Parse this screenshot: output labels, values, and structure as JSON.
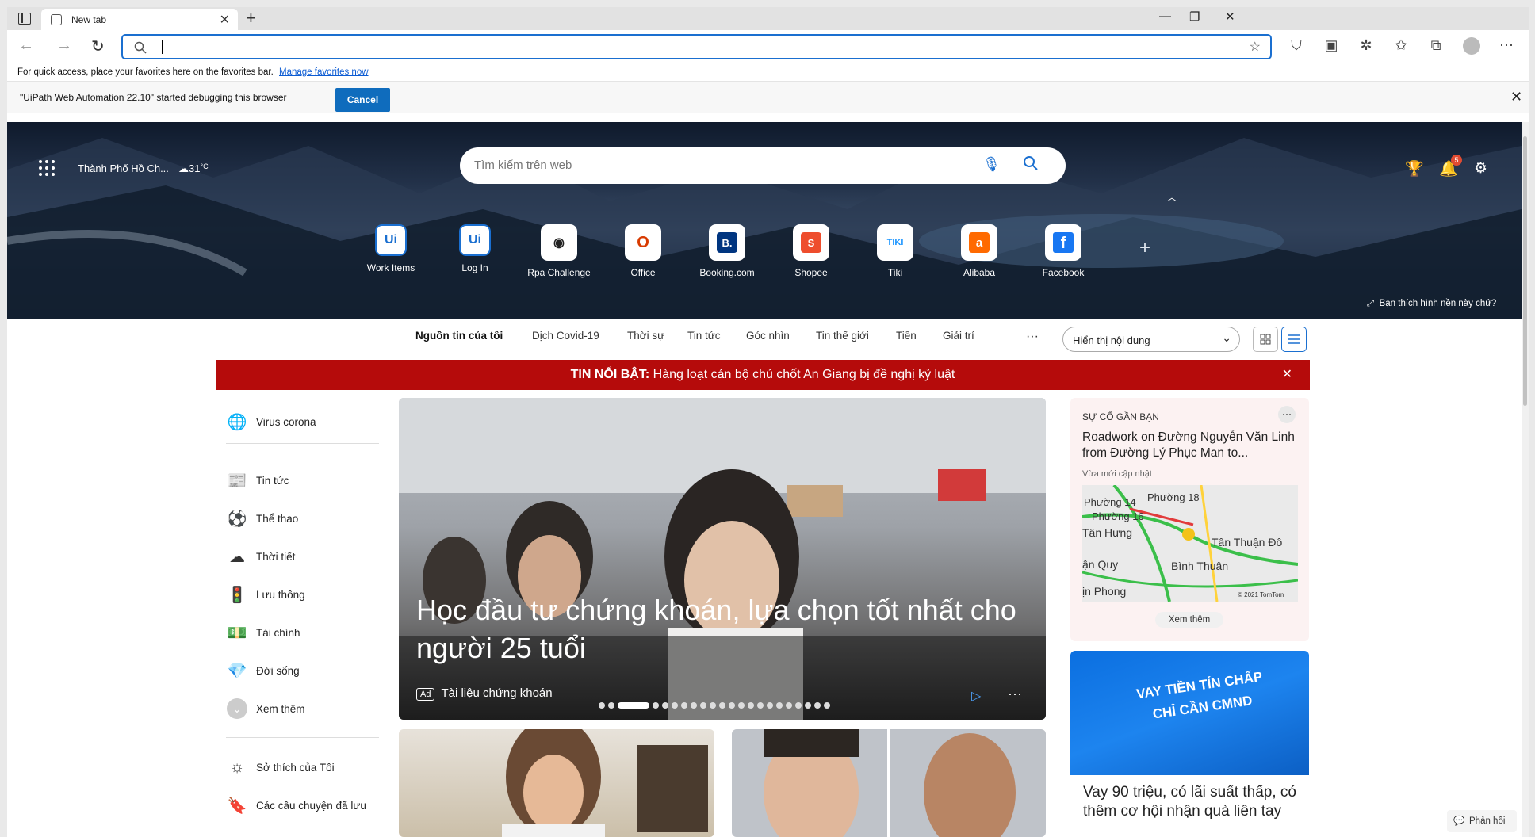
{
  "browser": {
    "tab_title": "New tab",
    "favorites_msg": "For quick access, place your favorites here on the favorites bar.",
    "favorites_link": "Manage favorites now",
    "info_msg": "\"UiPath Web Automation 22.10\" started debugging this browser",
    "cancel_label": "Cancel"
  },
  "hero": {
    "location": "Thành Phố Hồ Ch...",
    "temperature": "31",
    "temp_unit": "°C",
    "search_placeholder": "Tìm kiếm trên web",
    "notification_count": "5",
    "wallpaper_text": "Bạn thích hình nền này chứ?",
    "tiles": [
      {
        "label": "Work Items",
        "glyph": "Ui",
        "color": "#1a6fd0"
      },
      {
        "label": "Log In",
        "glyph": "Ui",
        "color": "#1a6fd0"
      },
      {
        "label": "Rpa Challenge",
        "glyph": "◉",
        "color": "#222222"
      },
      {
        "label": "Office",
        "glyph": "O",
        "color": "#d83b01"
      },
      {
        "label": "Booking.com",
        "glyph": "B.",
        "color": "#ffffff"
      },
      {
        "label": "Shopee",
        "glyph": "S",
        "color": "#ffffff"
      },
      {
        "label": "Tiki",
        "glyph": "TIKI",
        "color": "#1a94ff"
      },
      {
        "label": "Alibaba",
        "glyph": "a",
        "color": "#ffffff"
      },
      {
        "label": "Facebook",
        "glyph": "f",
        "color": "#ffffff"
      }
    ]
  },
  "news_nav": {
    "items": [
      "Nguồn tin của tôi",
      "Dịch Covid-19",
      "Thời sự",
      "Tin tức",
      "Góc nhìn",
      "Tin thế giới",
      "Tiền",
      "Giải trí"
    ],
    "more": "···",
    "dropdown": "Hiển thị nội dung"
  },
  "breaking": {
    "label": "TIN NỔI BẬT:",
    "text": "Hàng loạt cán bộ chủ chốt An Giang bị đề nghị kỷ luật"
  },
  "rail": {
    "items": [
      "Virus corona",
      "Tin tức",
      "Thể thao",
      "Thời tiết",
      "Lưu thông",
      "Tài chính",
      "Đời sống",
      "Xem thêm",
      "Sở thích của Tôi",
      "Các câu chuyện đã lưu"
    ]
  },
  "hero_card": {
    "title": "Học đầu tư chứng khoán, lựa chọn tốt nhất cho người 25 tuổi",
    "ad_tag": "Ad",
    "source": "Tài liệu chứng khoán"
  },
  "traffic_card": {
    "label": "SỰ CỐ GẦN BẠN",
    "headline": "Roadwork on Đường Nguyễn Văn Linh from Đường Lý Phục Man to...",
    "updated": "Vừa mới cập nhật",
    "map_labels": [
      "Phường 18",
      "Phường 14",
      "Phường 16",
      "Tân Hưng",
      "Tân Thuận Đô",
      "ận Quy",
      "Bình Thuận",
      "ịn Phong"
    ],
    "map_copyright": "© 2021 TomTom",
    "see_more": "Xem thêm"
  },
  "ad_card": {
    "banner": "VAY TIỀN TÍN CHẤP CHỈ CẦN CMND",
    "title": "Vay 90 triệu, có lãi suất thấp, có thêm cơ hội nhận quà liên tay"
  },
  "feedback": "Phản hồi"
}
